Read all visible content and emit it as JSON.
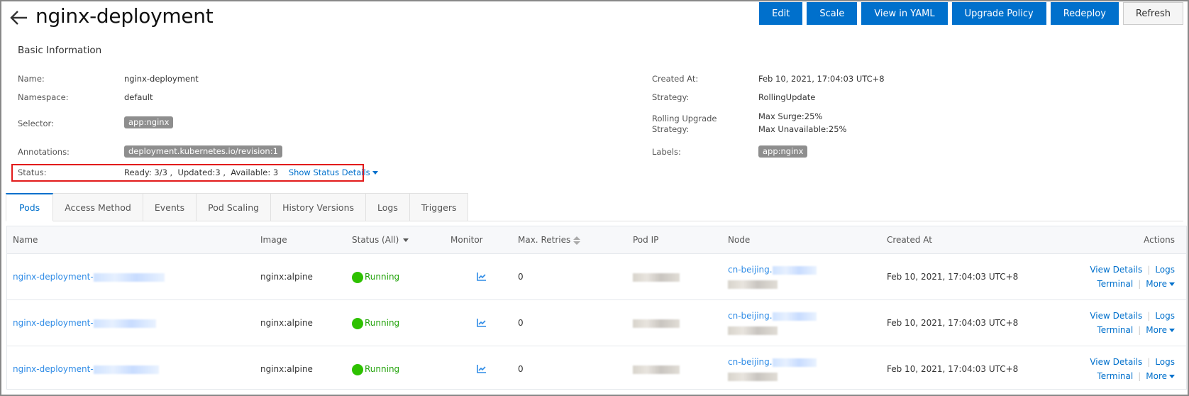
{
  "header": {
    "title": "nginx-deployment",
    "buttons": {
      "edit": "Edit",
      "scale": "Scale",
      "view_yaml": "View in YAML",
      "upgrade_policy": "Upgrade Policy",
      "redeploy": "Redeploy",
      "refresh": "Refresh"
    }
  },
  "basic_info": {
    "title": "Basic Information",
    "left": {
      "name_label": "Name:",
      "name_value": "nginx-deployment",
      "namespace_label": "Namespace:",
      "namespace_value": "default",
      "selector_label": "Selector:",
      "selector_tag": "app:nginx",
      "annotations_label": "Annotations:",
      "annotations_tag": "deployment.kubernetes.io/revision:1",
      "status_label": "Status:",
      "status_value": "Ready: 3/3 ,  Updated:3 ,  Available: 3",
      "status_link": "Show Status Details"
    },
    "right": {
      "created_label": "Created At:",
      "created_value": "Feb 10, 2021, 17:04:03 UTC+8",
      "strategy_label": "Strategy:",
      "strategy_value": "RollingUpdate",
      "rolling_label_1": "Rolling Upgrade",
      "rolling_label_2": "Strategy:",
      "max_surge": "Max Surge:25%",
      "max_unavailable": "Max Unavailable:25%",
      "labels_label": "Labels:",
      "labels_tag": "app:nginx"
    }
  },
  "tabs": [
    {
      "label": "Pods",
      "active": true
    },
    {
      "label": "Access Method"
    },
    {
      "label": "Events"
    },
    {
      "label": "Pod Scaling"
    },
    {
      "label": "History Versions"
    },
    {
      "label": "Logs"
    },
    {
      "label": "Triggers"
    }
  ],
  "table": {
    "columns": {
      "name": "Name",
      "image": "Image",
      "status": "Status (All)",
      "monitor": "Monitor",
      "retries": "Max. Retries",
      "pod_ip": "Pod IP",
      "node": "Node",
      "created": "Created At",
      "actions": "Actions"
    },
    "rows": [
      {
        "name_prefix": "nginx-deployment-",
        "image": "nginx:alpine",
        "status": "Running",
        "retries": "0",
        "node_prefix": "cn-beijing.",
        "created": "Feb 10, 2021, 17:04:03 UTC+8"
      },
      {
        "name_prefix": "nginx-deployment-",
        "image": "nginx:alpine",
        "status": "Running",
        "retries": "0",
        "node_prefix": "cn-beijing.",
        "created": "Feb 10, 2021, 17:04:03 UTC+8"
      },
      {
        "name_prefix": "nginx-deployment-",
        "image": "nginx:alpine",
        "status": "Running",
        "retries": "0",
        "node_prefix": "cn-beijing.",
        "created": "Feb 10, 2021, 17:04:03 UTC+8"
      }
    ],
    "actions": {
      "view_details": "View Details",
      "logs": "Logs",
      "terminal": "Terminal",
      "more": "More"
    }
  },
  "colors": {
    "primary": "#0070cc",
    "running": "#2ec100",
    "highlight_border": "#e21b1b"
  }
}
